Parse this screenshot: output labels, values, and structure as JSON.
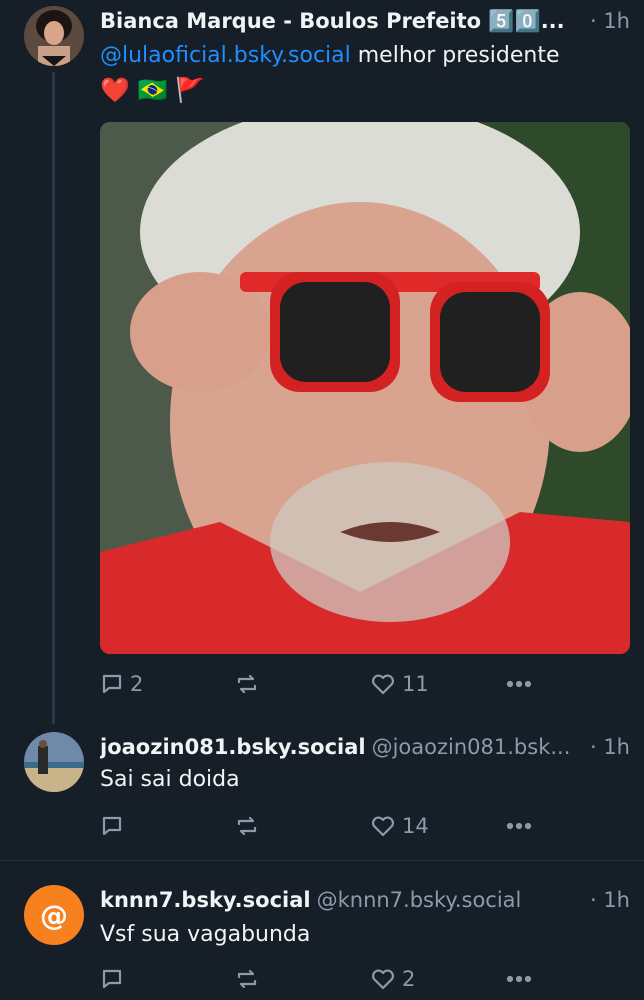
{
  "posts": [
    {
      "author": "Bianca Marque - Boulos Prefeito 5️⃣0️⃣...",
      "time": "· 1h",
      "mention": "@lulaoficial.bsky.social",
      "text": " melhor presidente",
      "emojis": "❤️ 🇧🇷 🚩",
      "replies": "2",
      "reposts": "",
      "likes": "11"
    },
    {
      "author": "joaozin081.bsky.social",
      "handle": "@joaozin081.bsk...",
      "time": "· 1h",
      "text": "Sai sai doida",
      "replies": "",
      "reposts": "",
      "likes": "14"
    },
    {
      "author": "knnn7.bsky.social",
      "handle": "@knnn7.bsky.social",
      "time": "· 1h",
      "text": "Vsf sua vagabunda",
      "replies": "",
      "reposts": "",
      "likes": "2"
    }
  ],
  "colors": {
    "background": "#161e27",
    "accent": "#1f8fff",
    "muted": "#8c9bab",
    "avatar_orange": "#f7801f",
    "shirt_red": "#d82a2a"
  },
  "icons": [
    "reply-icon",
    "repost-icon",
    "like-icon",
    "more-icon",
    "at-sign-icon"
  ]
}
